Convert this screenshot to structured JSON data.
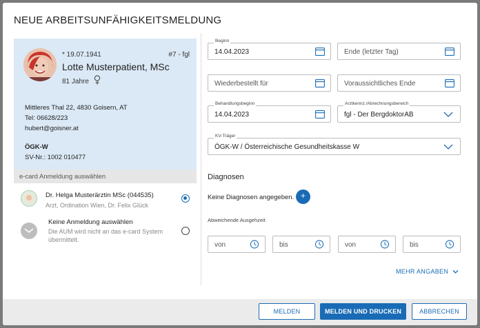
{
  "dialog": {
    "title": "NEUE ARBEITSUNFÄHIGKEITSMELDUNG"
  },
  "patient": {
    "dob": "* 19.07.1941",
    "id": "#7 - fgl",
    "name": "Lotte Musterpatient, MSc",
    "age": "81 Jahre",
    "address": "Mittleres Thal 22, 4830 Goisern, AT",
    "tel": "Tel: 06628/223",
    "email": "hubert@goisner.at",
    "insurance": "ÖGK-W",
    "svnr": "SV-Nr.: 1002 010477"
  },
  "ecard": {
    "header": "e-card Anmeldung auswählen",
    "options": [
      {
        "title": "Dr. Helga Musterärztin MSc (044535)",
        "subtitle": "Arzt, Ordination Wien, Dr. Felix Glück",
        "selected": true
      },
      {
        "title": "Keine Anmeldung auswählen",
        "subtitle": "Die AUM wird nicht an das e-card System übermittelt.",
        "selected": false
      }
    ]
  },
  "form": {
    "beginn": {
      "label": "Beginn",
      "value": "14.04.2023"
    },
    "ende": {
      "placeholder": "Ende (letzter Tag)"
    },
    "wiederbestellt": {
      "placeholder": "Wiederbestellt für"
    },
    "voraussichtlich": {
      "placeholder": "Voraussichtliches Ende"
    },
    "behandlungsbeginn": {
      "label": "Behandlungsbeginn",
      "value": "14.04.2023"
    },
    "arztkennz": {
      "label": "Arztkennz./Abrechnungsbereich",
      "value": "fgl - Der BergdoktorAB"
    },
    "kv": {
      "label": "KV-Träger",
      "value": "ÖGK-W / Österreichische Gesundheitskasse W"
    }
  },
  "diagnosen": {
    "title": "Diagnosen",
    "empty": "Keine Diagnosen angegeben.",
    "add": "+"
  },
  "ausgehzeit": {
    "title": "Abweichende Ausgehzeit",
    "fields": [
      "von",
      "bis",
      "von",
      "bis"
    ]
  },
  "more_label": "MEHR ANGABEN",
  "footer": {
    "melden": "MELDEN",
    "melden_drucken": "MELDEN UND DRUCKEN",
    "abbrechen": "ABBRECHEN"
  },
  "colors": {
    "accent": "#1a6bb5",
    "patient_bg": "#dbe9f6"
  }
}
